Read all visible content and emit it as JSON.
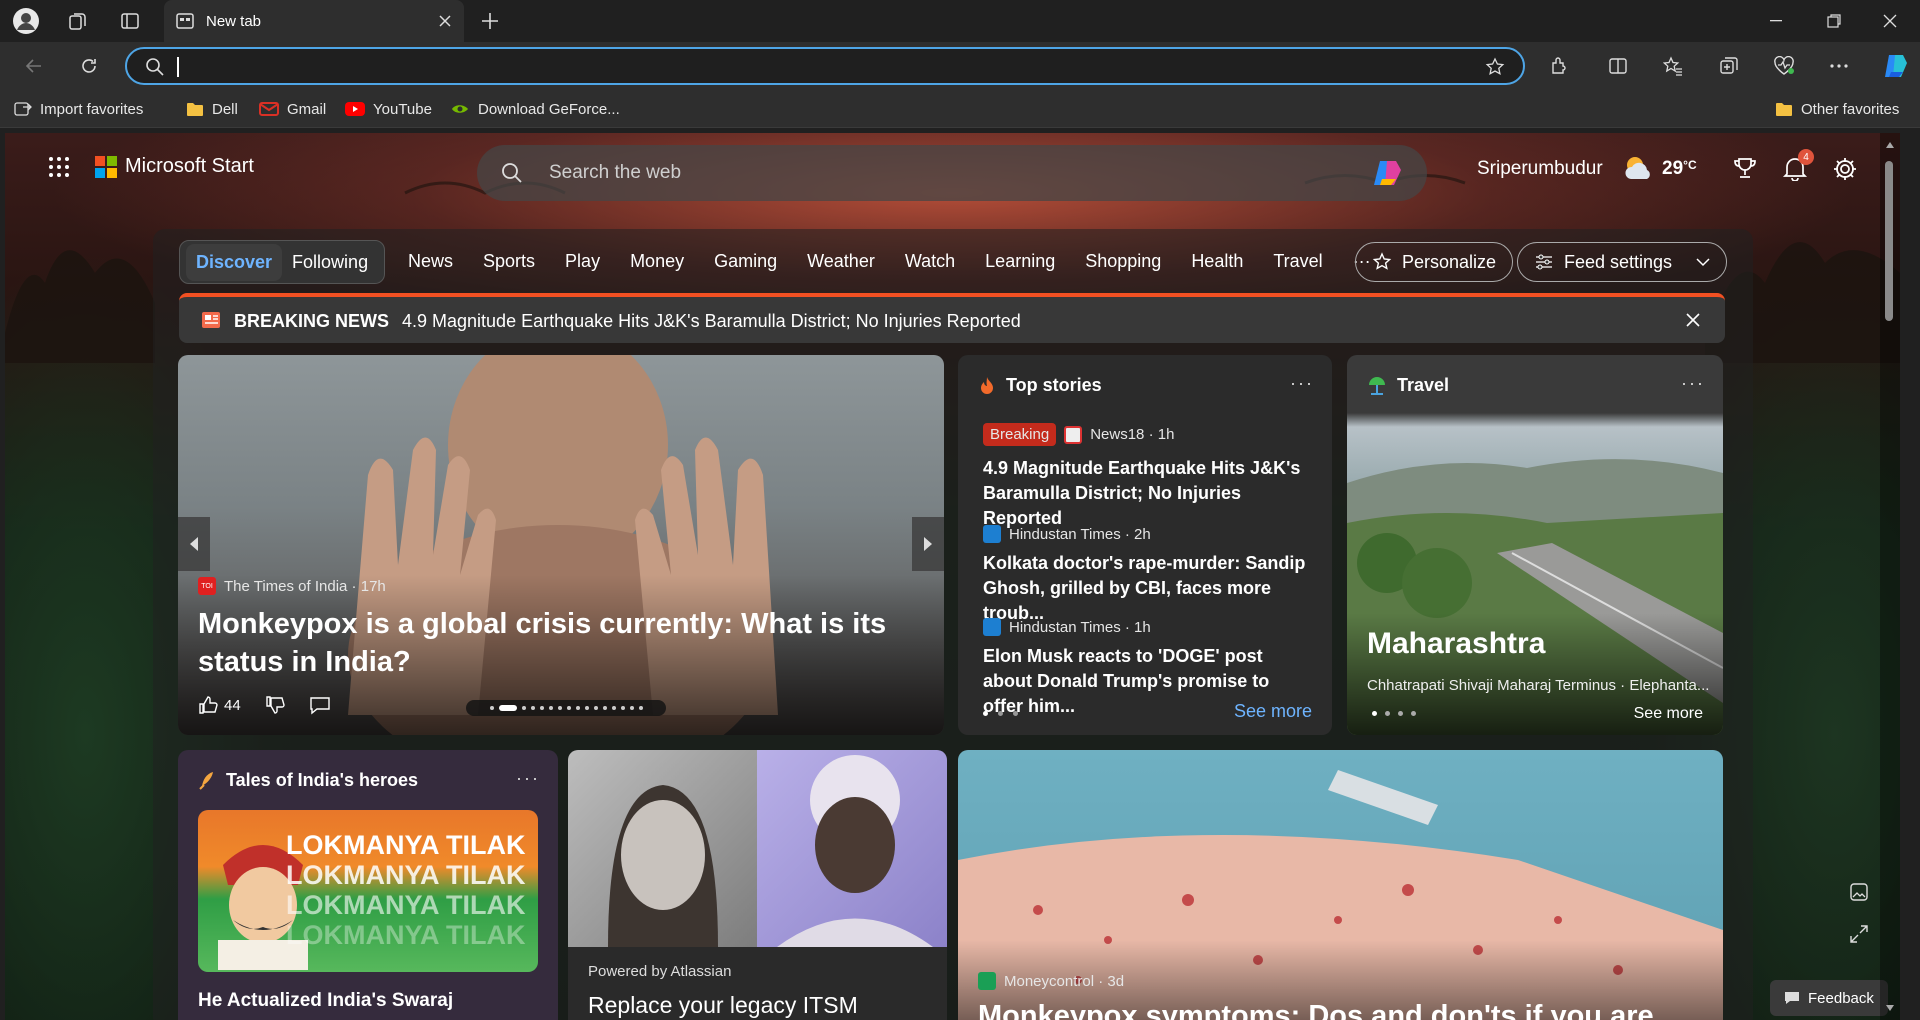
{
  "browser": {
    "tab_title": "New tab",
    "favorites": [
      {
        "label": "Import favorites",
        "icon": "import-icon"
      },
      {
        "label": "Dell",
        "icon": "folder-icon"
      },
      {
        "label": "Gmail",
        "icon": "gmail-icon"
      },
      {
        "label": "YouTube",
        "icon": "youtube-icon"
      },
      {
        "label": "Download GeForce...",
        "icon": "nvidia-icon"
      }
    ],
    "other_favorites": "Other favorites",
    "address_value": ""
  },
  "start": {
    "brand": "Microsoft Start",
    "search_placeholder": "Search the web",
    "location": "Sriperumbudur",
    "temperature": "29",
    "temp_unit": "°C",
    "notification_count": "4"
  },
  "nav": {
    "discover": "Discover",
    "following": "Following",
    "topics": [
      "News",
      "Sports",
      "Play",
      "Money",
      "Gaming",
      "Weather",
      "Watch",
      "Learning",
      "Shopping",
      "Health",
      "Travel"
    ],
    "more": "···",
    "personalize": "Personalize",
    "feed_settings": "Feed settings"
  },
  "breaking": {
    "label": "BREAKING NEWS",
    "text": "4.9 Magnitude Earthquake Hits J&K's Baramulla District; No Injuries Reported"
  },
  "hero": {
    "source": "The Times of India · 17h",
    "source_logo": "TOI",
    "title": "Monkeypox is a global crisis currently: What is its status in India?",
    "likes": "44"
  },
  "top_stories": {
    "title": "Top stories",
    "items": [
      {
        "badge": "Breaking",
        "source": "News18 · 1h",
        "headline": "4.9 Magnitude Earthquake Hits J&K's Baramulla District; No Injuries Reported"
      },
      {
        "badge": "",
        "source": "Hindustan Times · 2h",
        "headline": "Kolkata doctor's rape-murder: Sandip Ghosh, grilled by CBI, faces more troub..."
      },
      {
        "badge": "",
        "source": "Hindustan Times · 1h",
        "headline": "Elon Musk reacts to 'DOGE' post about Donald Trump's promise to offer him..."
      }
    ],
    "see_more": "See more"
  },
  "travel": {
    "title": "Travel",
    "place": "Maharashtra",
    "subtitle": "Chhatrapati Shivaji Maharaj Terminus · Elephanta...",
    "see_more": "See more"
  },
  "heroes": {
    "title": "Tales of India's heroes",
    "banner_text": "LOKMANYA TILAK",
    "headline": "He Actualized India's Swaraj"
  },
  "ad": {
    "powered": "Powered by Atlassian",
    "headline": "Replace your legacy ITSM"
  },
  "bottom_story": {
    "source": "Moneycontrol · 3d",
    "headline": "Monkeypox symptoms: Dos and don'ts if you are"
  },
  "feedback": "Feedback",
  "colors": {
    "accent": "#4ea5e6",
    "breaking_red": "#c42b1c",
    "nav_accent": "#f25022"
  }
}
